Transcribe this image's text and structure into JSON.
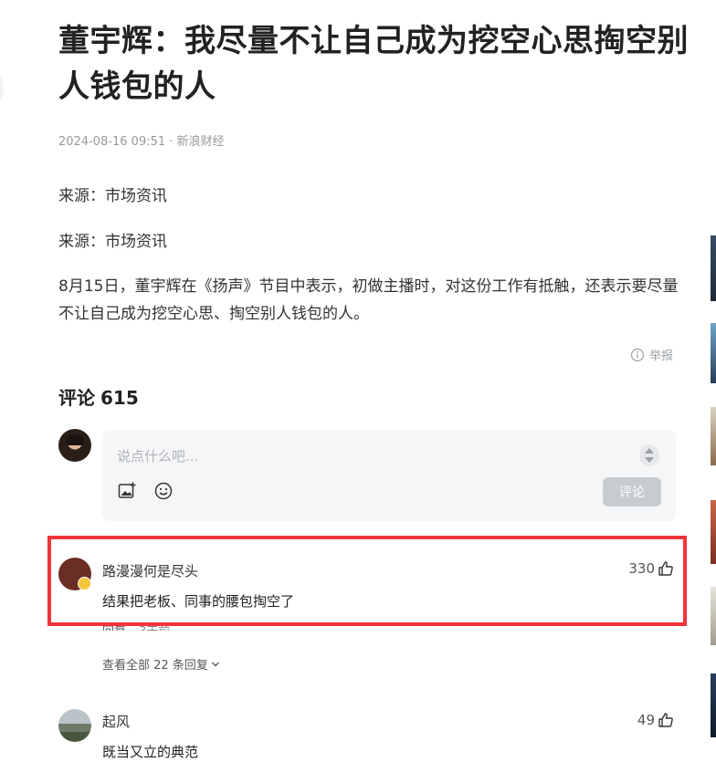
{
  "article": {
    "title": "董宇辉：我尽量不让自己成为挖空心思掏空别人钱包的人",
    "meta": "2024-08-16 09:51 · 新浪财经",
    "paragraphs": [
      "来源：市场资讯",
      "来源：市场资讯",
      "8月15日，董宇辉在《扬声》节目中表示，初做主播时，对这份工作有抵触，还表示要尽量不让自己成为挖空心思、掏空别人钱包的人。"
    ],
    "report_label": "举报"
  },
  "comments": {
    "heading_label": "评论",
    "count": "615",
    "input_placeholder": "说点什么吧...",
    "submit_label": "评论",
    "list": [
      {
        "user": "路漫漫何是尽头",
        "text": "结果把老板、同事的腰包掏空了",
        "likes": "330",
        "reply_label": "回复",
        "time": "3天前",
        "view_all_label": "查看全部 22 条回复"
      },
      {
        "user": "起风",
        "text": "既当又立的典范",
        "likes": "49"
      }
    ]
  },
  "icons": {
    "report": "info-circle-icon",
    "image": "image-add-icon",
    "emoji": "smiley-icon",
    "like": "thumbs-up-icon",
    "expand": "chevron-down-icon"
  },
  "colors": {
    "highlight": "#f2333b",
    "submit_disabled": "#c8cbd0",
    "input_bg": "#f5f6f7"
  }
}
